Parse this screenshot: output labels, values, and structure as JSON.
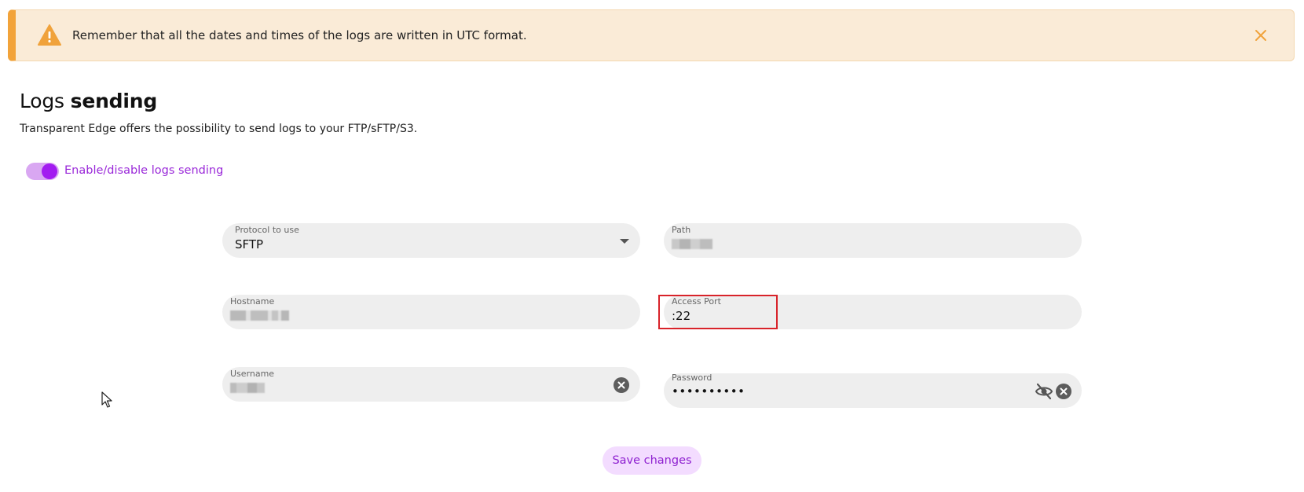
{
  "alert": {
    "text": "Remember that all the dates and times of the logs are written in UTC format.",
    "icon": "warning-icon",
    "close_icon": "close-icon",
    "accent_color": "#f2a33a",
    "background_color": "#faebd7"
  },
  "header": {
    "title_light": "Logs",
    "title_bold": "sending",
    "subtitle": "Transparent Edge offers the possibility to send logs to your FTP/sFTP/S3."
  },
  "toggle": {
    "label": "Enable/disable logs sending",
    "enabled": true,
    "color": "#a21cf0"
  },
  "form": {
    "protocol": {
      "label": "Protocol to use",
      "value": "SFTP"
    },
    "path": {
      "label": "Path",
      "value": ""
    },
    "hostname": {
      "label": "Hostname",
      "value": ""
    },
    "access_port": {
      "label": "Access Port",
      "value": ":22"
    },
    "username": {
      "label": "Username",
      "value": ""
    },
    "password": {
      "label": "Password",
      "value": "••••••••••"
    }
  },
  "save_button": {
    "label": "Save changes"
  }
}
